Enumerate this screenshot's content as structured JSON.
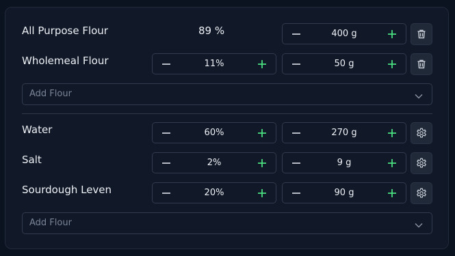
{
  "flours": [
    {
      "name": "All Purpose Flour",
      "percent": "89 %",
      "weight": "400 g"
    },
    {
      "name": "Wholemeal Flour",
      "percent": "11%",
      "weight": "50 g"
    }
  ],
  "add_flour_top": {
    "placeholder": "Add Flour"
  },
  "ingredients": [
    {
      "name": "Water",
      "percent": "60%",
      "weight": "270 g"
    },
    {
      "name": "Salt",
      "percent": "2%",
      "weight": "9 g"
    },
    {
      "name": "Sourdough Leven",
      "percent": "20%",
      "weight": "90 g"
    }
  ],
  "add_flour_bottom": {
    "placeholder": "Add Flour"
  },
  "icons": {
    "decrement": "minus-icon",
    "increment": "plus-icon",
    "delete": "trash-icon",
    "settings": "gear-icon",
    "dropdown": "chevron-down-icon"
  },
  "colors": {
    "accent": "#4ade80",
    "background": "#111827"
  }
}
